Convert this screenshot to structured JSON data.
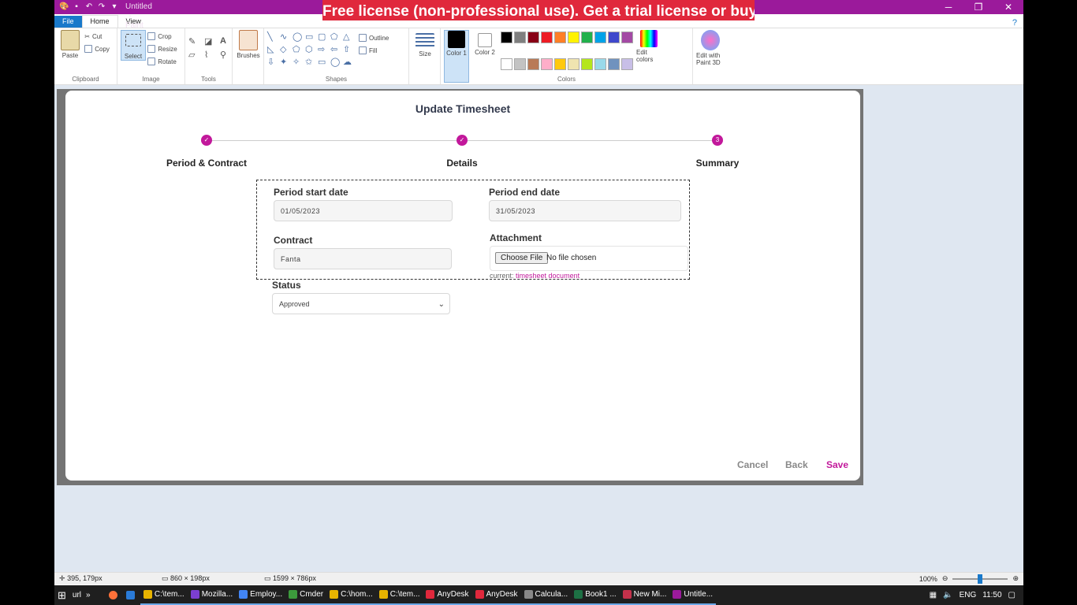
{
  "window": {
    "title": "Untitled - Paint",
    "banner": "Free license (non-professional use). Get a trial license or buy"
  },
  "menu": {
    "file": "File",
    "home": "Home",
    "view": "View",
    "help": "?"
  },
  "ribbon": {
    "clipboard": {
      "paste": "Paste",
      "cut": "Cut",
      "copy": "Copy",
      "label": "Clipboard"
    },
    "image": {
      "select": "Select",
      "crop": "Crop",
      "resize": "Resize",
      "rotate": "Rotate",
      "label": "Image"
    },
    "tools": {
      "label": "Tools",
      "brushes": "Brushes"
    },
    "shapes": {
      "outline": "Outline",
      "fill": "Fill",
      "label": "Shapes"
    },
    "size": {
      "label": "Size"
    },
    "colors": {
      "color1": "Color 1",
      "color2": "Color 2",
      "edit": "Edit colors",
      "paint3d": "Edit with Paint 3D",
      "label": "Colors",
      "palette": [
        "#000000",
        "#7f7f7f",
        "#880015",
        "#ed1c24",
        "#ff7f27",
        "#fff200",
        "#22b14c",
        "#00a2e8",
        "#3f48cc",
        "#a349a4",
        "#ffffff",
        "#c3c3c3",
        "#b97a57",
        "#ffaec9",
        "#ffc90e",
        "#efe4b0",
        "#b5e61d",
        "#99d9ea",
        "#7092be",
        "#c8bfe7"
      ]
    }
  },
  "modal": {
    "title": "Update Timesheet",
    "steps": [
      {
        "label": "Period & Contract",
        "mark": "✓"
      },
      {
        "label": "Details",
        "mark": "✓"
      },
      {
        "label": "Summary",
        "mark": "3"
      }
    ],
    "fields": {
      "period_start_label": "Period start date",
      "period_start_value": "01/05/2023",
      "period_end_label": "Period end date",
      "period_end_value": "31/05/2023",
      "contract_label": "Contract",
      "contract_value": "Fanta",
      "attachment_label": "Attachment",
      "choose_file": "Choose File",
      "no_file": "No file chosen",
      "current_prefix": "current:",
      "current_link": "timesheet document",
      "status_label": "Status",
      "status_value": "Approved"
    },
    "buttons": {
      "cancel": "Cancel",
      "back": "Back",
      "save": "Save"
    }
  },
  "statusbar": {
    "cursor": "395, 179px",
    "selection": "860 × 198px",
    "canvas": "1599 × 786px",
    "zoom": "100%"
  },
  "taskbar": {
    "search": "url",
    "items": [
      "C:\\tem...",
      "Mozilla...",
      "Employ...",
      "Cmder",
      "C:\\hom...",
      "C:\\tem...",
      "AnyDesk",
      "AnyDesk",
      "Calcula...",
      "Book1 ...",
      "New Mi...",
      "Untitle..."
    ],
    "lang": "ENG",
    "time": "11:50"
  }
}
